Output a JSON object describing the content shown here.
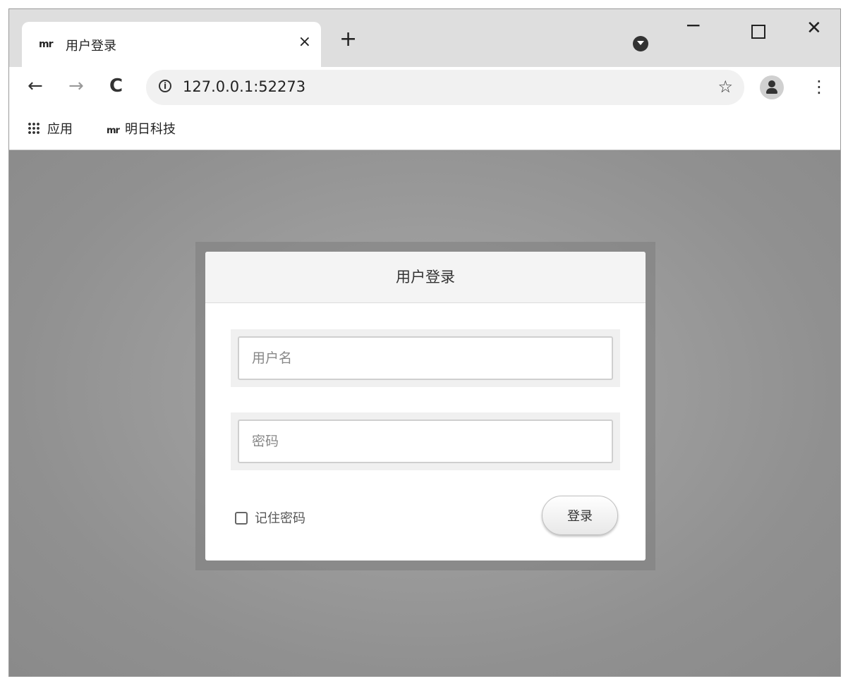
{
  "browser": {
    "tab": {
      "favicon_text": "mr",
      "title": "用户登录",
      "close_glyph": "×"
    },
    "new_tab_glyph": "+",
    "window_controls": {
      "minimize": "−",
      "close": "✕"
    },
    "toolbar": {
      "back": "←",
      "forward": "→",
      "reload": "C",
      "info_glyph": "i",
      "url": "127.0.0.1:52273",
      "star": "☆",
      "menu": "⋮"
    },
    "bookmarks": [
      {
        "label": "应用",
        "icon": "apps-grid-icon"
      },
      {
        "label": "明日科技",
        "logo": "mr",
        "icon": "mingri-logo"
      }
    ]
  },
  "login": {
    "title": "用户登录",
    "username_placeholder": "用户名",
    "password_placeholder": "密码",
    "remember_label": "记住密码",
    "remember_checked": false,
    "submit_label": "登录"
  }
}
